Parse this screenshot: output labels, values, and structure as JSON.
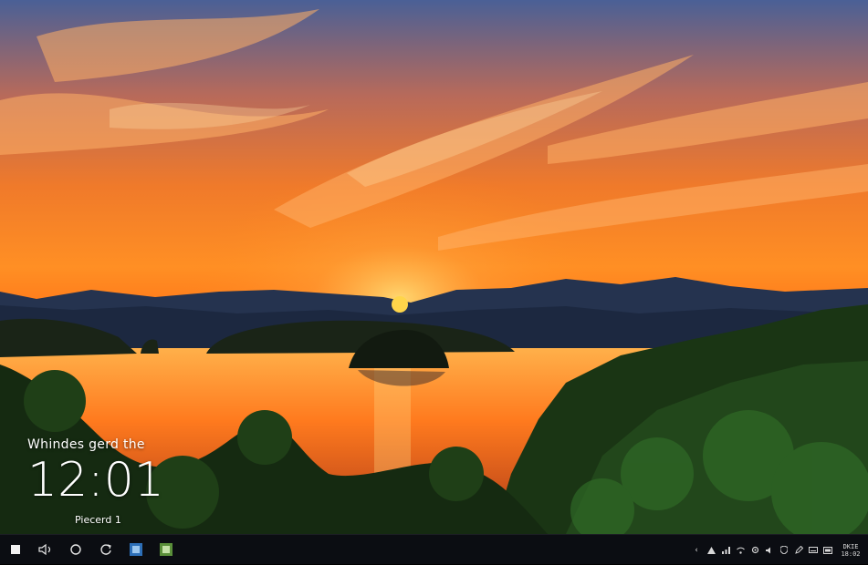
{
  "lock_screen": {
    "greeting": "Whindes gerd the",
    "clock": "12:01",
    "subtitle": "Piecerd 1"
  },
  "taskbar": {
    "items": [
      {
        "name": "start-button",
        "icon": "windows-square-icon"
      },
      {
        "name": "volume-button",
        "icon": "speaker-icon"
      },
      {
        "name": "search-button",
        "icon": "circle-icon"
      },
      {
        "name": "refresh-button",
        "icon": "refresh-icon"
      },
      {
        "name": "app-blue-button",
        "icon": "app-tile-blue-icon"
      },
      {
        "name": "app-green-button",
        "icon": "app-tile-green-icon"
      }
    ],
    "tray": {
      "clock_line1": "DKIE",
      "clock_line2": "18:02"
    }
  },
  "colors": {
    "sky_top": "#3f5a8a",
    "sky_orange": "#ff8a1e",
    "sun": "#ffcc33",
    "mountain": "#1b2a44",
    "lake": "#ff9430",
    "forest": "#1d3a17",
    "taskbar": "#0b0d12"
  }
}
